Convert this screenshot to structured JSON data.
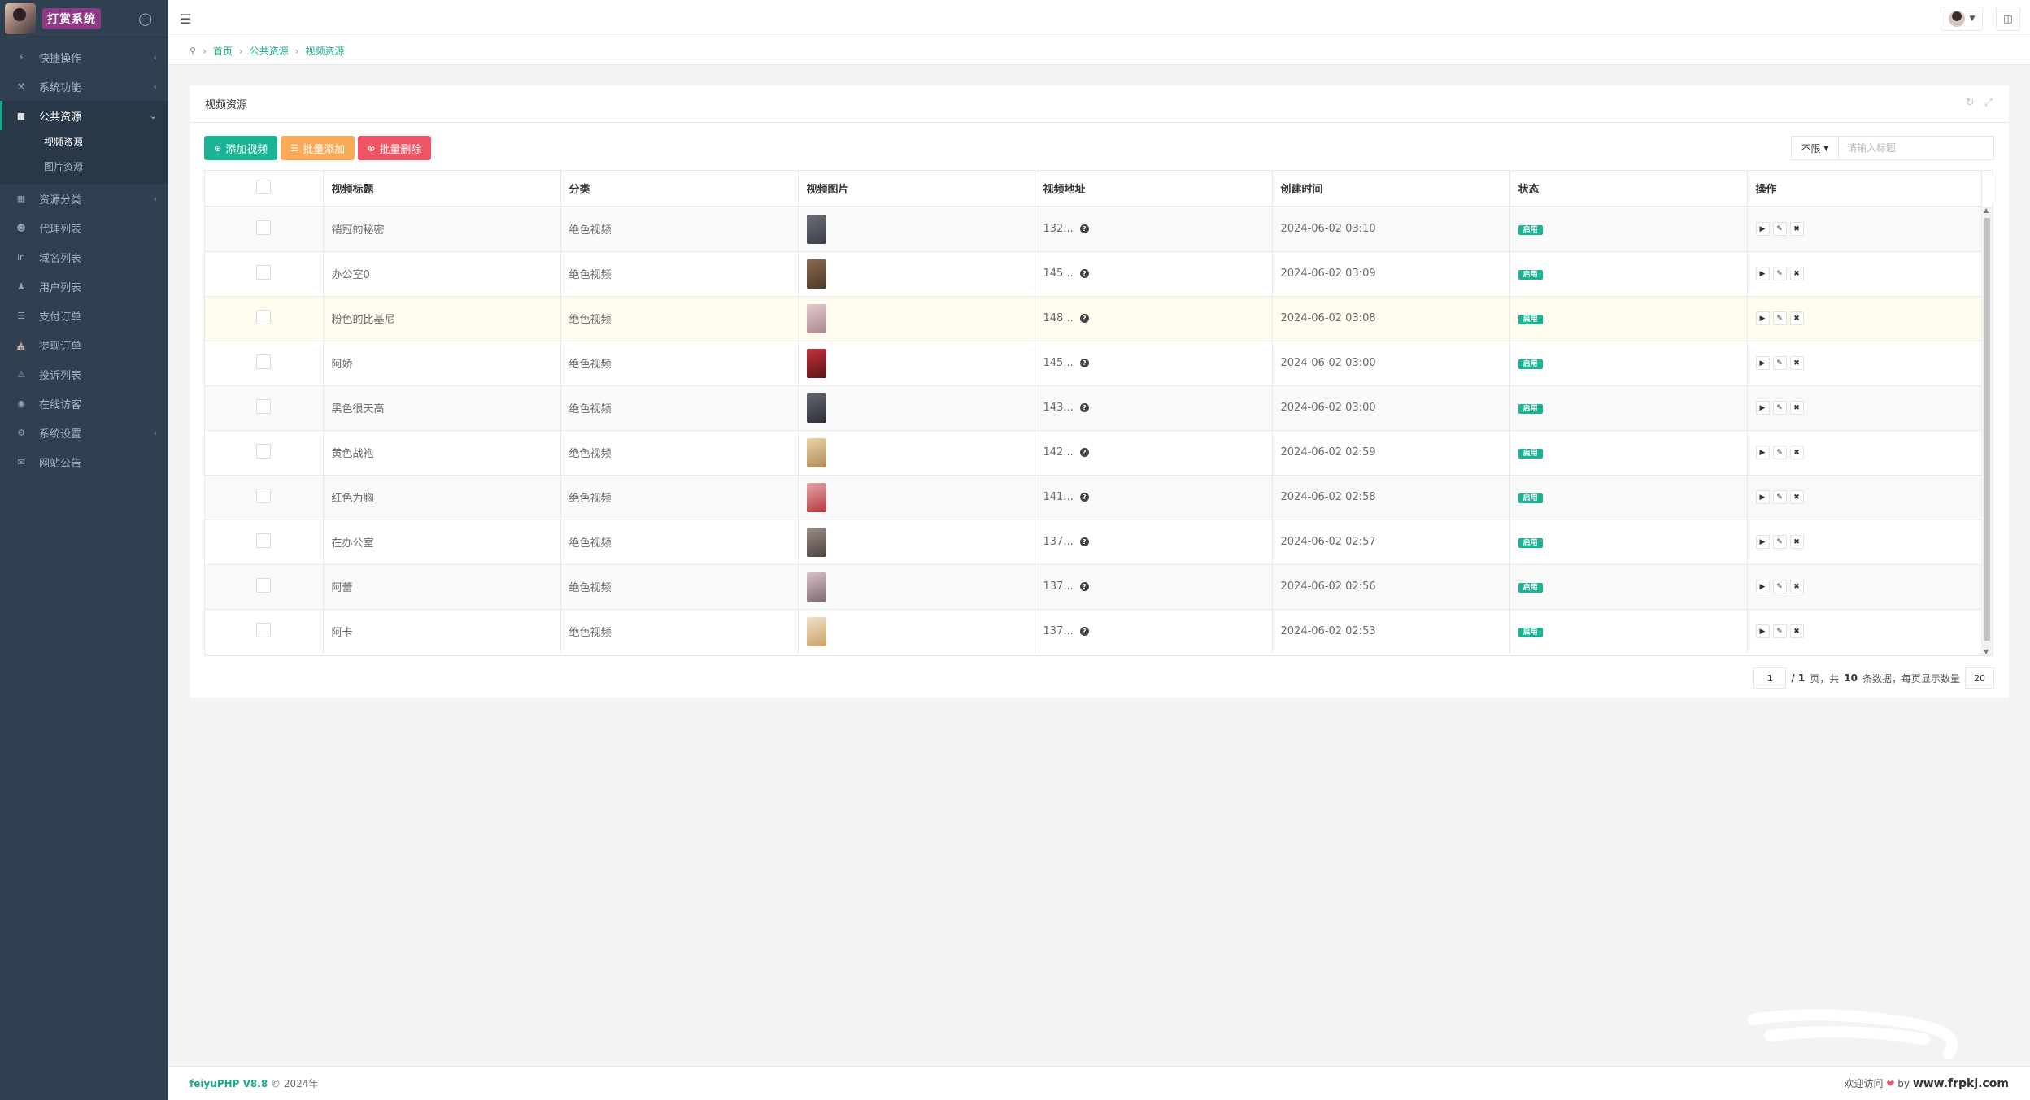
{
  "brand": {
    "name": "打赏系统",
    "avatar_icon": "avatar-image"
  },
  "sidebar": {
    "items": [
      {
        "label": "快捷操作",
        "icon": "bolt-icon",
        "has_children": true
      },
      {
        "label": "系统功能",
        "icon": "wrench-icon",
        "has_children": true
      },
      {
        "label": "公共资源",
        "icon": "video-icon",
        "has_children": true,
        "expanded": true,
        "children": [
          {
            "label": "视频资源",
            "active": true
          },
          {
            "label": "图片资源"
          }
        ]
      },
      {
        "label": "资源分类",
        "icon": "grid-icon",
        "has_children": true
      },
      {
        "label": "代理列表",
        "icon": "users-icon"
      },
      {
        "label": "域名列表",
        "icon": "linkedin-icon"
      },
      {
        "label": "用户列表",
        "icon": "user-icon"
      },
      {
        "label": "支付订单",
        "icon": "list-icon"
      },
      {
        "label": "提现订单",
        "icon": "bank-icon"
      },
      {
        "label": "投诉列表",
        "icon": "warning-icon"
      },
      {
        "label": "在线访客",
        "icon": "globe-icon"
      },
      {
        "label": "系统设置",
        "icon": "gear-icon",
        "has_children": true
      },
      {
        "label": "网站公告",
        "icon": "bullhorn-icon"
      }
    ]
  },
  "breadcrumb": [
    "首页",
    "公共资源",
    "视频资源"
  ],
  "panel": {
    "title": "视频资源"
  },
  "toolbar": {
    "add_label": "添加视频",
    "batch_add_label": "批量添加",
    "batch_delete_label": "批量删除"
  },
  "search": {
    "select_label": "不限",
    "placeholder": "请输入标题"
  },
  "table": {
    "headers": [
      "视频标题",
      "分类",
      "视频图片",
      "视频地址",
      "创建时间",
      "状态",
      "操作"
    ],
    "rows": [
      {
        "title": "销冠的秘密",
        "category": "绝色视频",
        "address": "132...",
        "created": "2024-06-02 03:10",
        "status": "启用",
        "thumb": [
          "#6b6e74",
          "#3b3f48"
        ]
      },
      {
        "title": "办公室0",
        "category": "绝色视频",
        "address": "145...",
        "created": "2024-06-02 03:09",
        "status": "启用",
        "thumb": [
          "#8a6a4e",
          "#4e3a2c"
        ]
      },
      {
        "title": "粉色的比基尼",
        "category": "绝色视频",
        "address": "148...",
        "created": "2024-06-02 03:08",
        "status": "启用",
        "thumb": [
          "#e7c9cf",
          "#a98790"
        ]
      },
      {
        "title": "阿娇",
        "category": "绝色视频",
        "address": "145...",
        "created": "2024-06-02 03:00",
        "status": "启用",
        "thumb": [
          "#c2323a",
          "#5e1418"
        ]
      },
      {
        "title": "黑色很天高",
        "category": "绝色视频",
        "address": "143...",
        "created": "2024-06-02 03:00",
        "status": "启用",
        "thumb": [
          "#62666e",
          "#2d3038"
        ]
      },
      {
        "title": "黄色战袍",
        "category": "绝色视频",
        "address": "142...",
        "created": "2024-06-02 02:59",
        "status": "启用",
        "thumb": [
          "#e9d5a6",
          "#b08a54"
        ]
      },
      {
        "title": "红色为胸",
        "category": "绝色视频",
        "address": "141...",
        "created": "2024-06-02 02:58",
        "status": "启用",
        "thumb": [
          "#e3a7a7",
          "#b7383e"
        ]
      },
      {
        "title": "在办公室",
        "category": "绝色视频",
        "address": "137...",
        "created": "2024-06-02 02:57",
        "status": "启用",
        "thumb": [
          "#9a8e88",
          "#4d4340"
        ]
      },
      {
        "title": "阿蕾",
        "category": "绝色视频",
        "address": "137...",
        "created": "2024-06-02 02:56",
        "status": "启用",
        "thumb": [
          "#d9c2c8",
          "#7e6a70"
        ]
      },
      {
        "title": "阿卡",
        "category": "绝色视频",
        "address": "137...",
        "created": "2024-06-02 02:53",
        "status": "启用",
        "thumb": [
          "#efe1c6",
          "#c9a36a"
        ]
      }
    ]
  },
  "pagination": {
    "page": "1",
    "total_pages_label": "/ 1",
    "page_suffix": "页，共",
    "total_count": "10",
    "count_suffix": "条数据，每页显示数量",
    "page_size": "20"
  },
  "footer": {
    "brand": "feiyuPHP V8.8",
    "copyright": "© 2024年",
    "welcome": "欢迎访问",
    "by": "by",
    "site": "www.frpkj.com"
  },
  "colors": {
    "sidebar_bg": "#2f4050",
    "accent": "#1ab394",
    "warning": "#f8ac59",
    "danger": "#ed5565"
  }
}
